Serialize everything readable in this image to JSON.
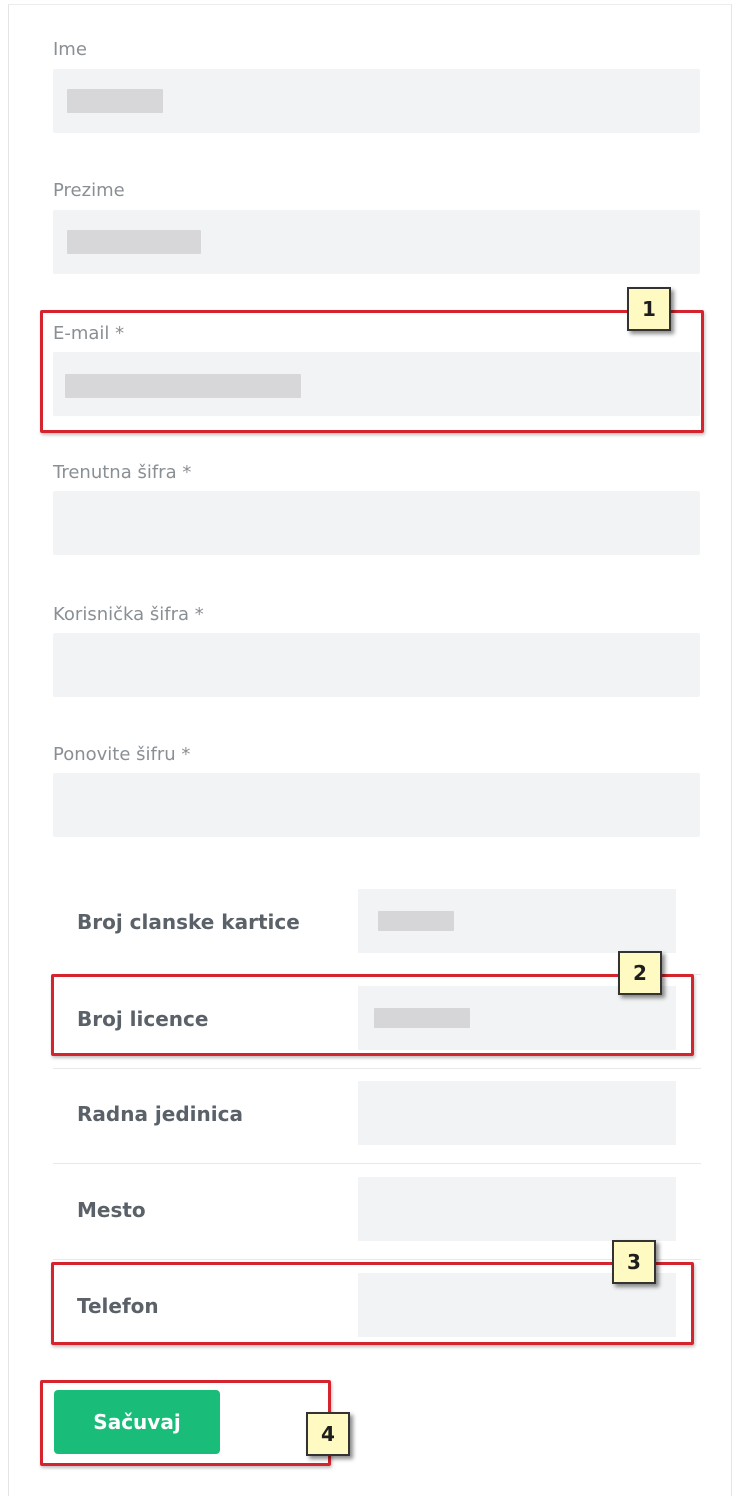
{
  "form": {
    "first_name": {
      "label": "Ime",
      "value": ""
    },
    "last_name": {
      "label": "Prezime",
      "value": ""
    },
    "email": {
      "label": "E-mail *",
      "value": ""
    },
    "current_password": {
      "label": "Trenutna šifra *",
      "value": ""
    },
    "user_password": {
      "label": "Korisnička šifra *",
      "value": ""
    },
    "repeat_password": {
      "label": "Ponovite šifru *",
      "value": ""
    }
  },
  "details": {
    "rows": [
      {
        "label": "Broj clanske kartice",
        "value": ""
      },
      {
        "label": "Broj licence",
        "value": ""
      },
      {
        "label": "Radna jedinica",
        "value": ""
      },
      {
        "label": "Mesto",
        "value": ""
      },
      {
        "label": "Telefon",
        "value": ""
      }
    ]
  },
  "actions": {
    "save_label": "Sačuvaj"
  },
  "annotations": {
    "badges": [
      "1",
      "2",
      "3",
      "4"
    ],
    "highlight_color": "#d6242e",
    "badge_color": "#fff9c2"
  },
  "colors": {
    "field_bg": "#f2f3f4",
    "save_button": "#19bd79",
    "label_text": "#8a8f94"
  }
}
